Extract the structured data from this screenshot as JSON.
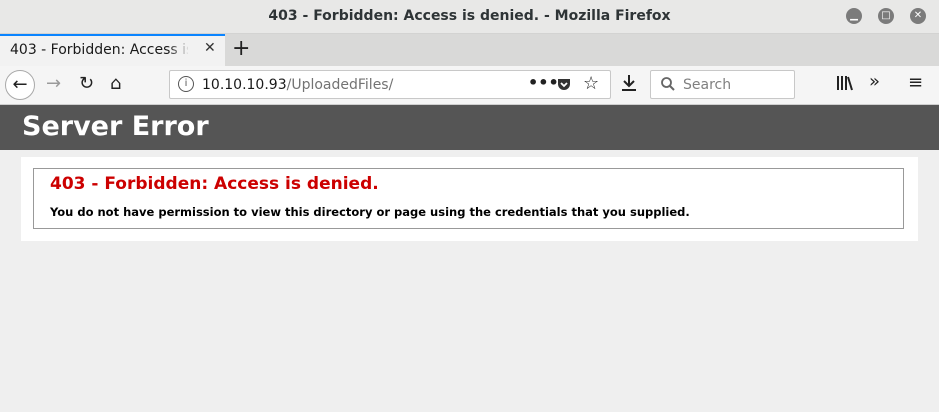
{
  "window": {
    "title": "403 - Forbidden: Access is denied. - Mozilla Firefox"
  },
  "tab": {
    "label": "403 - Forbidden: Access is denied.",
    "close_glyph": "✕"
  },
  "newtab_glyph": "+",
  "nav": {
    "url_host": "10.10.10.93",
    "url_path": "/UploadedFiles/",
    "search_placeholder": "Search"
  },
  "page": {
    "header": "Server Error",
    "error_title": "403 - Forbidden: Access is denied.",
    "error_message": "You do not have permission to view this directory or page using the credentials that you supplied."
  },
  "icons": [
    "minimize-icon",
    "maximize-icon",
    "close-icon",
    "back-arrow-icon",
    "forward-arrow-icon",
    "reload-icon",
    "home-icon",
    "info-icon",
    "page-actions-icon",
    "pocket-icon",
    "bookmark-star-icon",
    "download-icon",
    "search-icon",
    "library-icon",
    "overflow-chevrons-icon",
    "hamburger-menu-icon"
  ],
  "colors": {
    "header_bg": "#555555",
    "error_red": "#cc0000",
    "tab_accent": "#0a84ff"
  }
}
